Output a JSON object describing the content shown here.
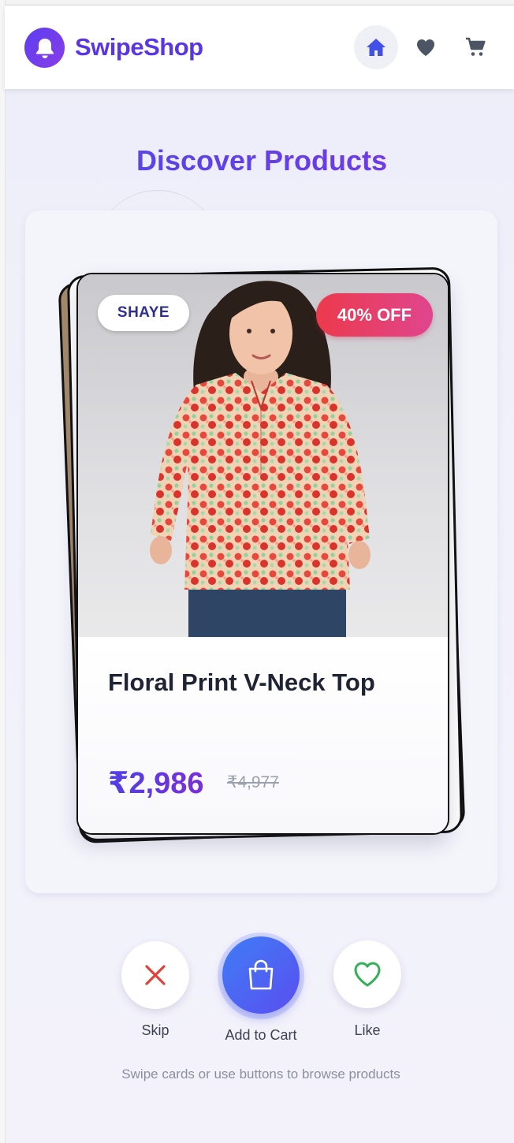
{
  "header": {
    "brand": "SwipeShop",
    "nav": [
      {
        "icon": "home-icon",
        "active": true
      },
      {
        "icon": "heart-icon",
        "active": false
      },
      {
        "icon": "cart-icon",
        "active": false
      }
    ]
  },
  "main": {
    "title": "Discover Products"
  },
  "card": {
    "brand_badge": "SHAYE",
    "discount_badge": "40% OFF",
    "product_name": "Floral Print V-Neck Top",
    "price": "₹2,986",
    "original_price": "₹4,977"
  },
  "actions": {
    "skip_label": "Skip",
    "cart_label": "Add to Cart",
    "like_label": "Like"
  },
  "hint": "Swipe cards or use buttons to browse products",
  "colors": {
    "accent": "#5a35e6",
    "discount": "#ec3a4c",
    "skip": "#e0413a",
    "like": "#34b05a",
    "cart_button": "#4a66f2"
  }
}
